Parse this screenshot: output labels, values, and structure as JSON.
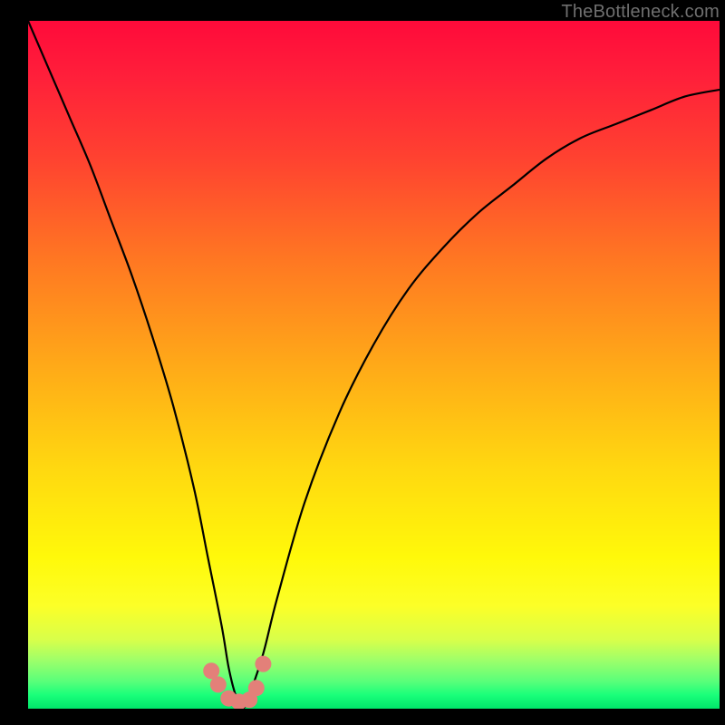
{
  "watermark": "TheBottleneck.com",
  "chart_data": {
    "type": "line",
    "title": "",
    "xlabel": "",
    "ylabel": "",
    "xlim": [
      0,
      100
    ],
    "ylim": [
      0,
      100
    ],
    "series": [
      {
        "name": "bottleneck-curve",
        "x": [
          0,
          3,
          6,
          9,
          12,
          15,
          18,
          21,
          24,
          26,
          28,
          29,
          30,
          31,
          32,
          34,
          36,
          40,
          45,
          50,
          55,
          60,
          65,
          70,
          75,
          80,
          85,
          90,
          95,
          100
        ],
        "values": [
          100,
          93,
          86,
          79,
          71,
          63,
          54,
          44,
          32,
          22,
          12,
          6,
          2,
          0,
          2,
          8,
          16,
          30,
          43,
          53,
          61,
          67,
          72,
          76,
          80,
          83,
          85,
          87,
          89,
          90
        ]
      }
    ],
    "markers": {
      "name": "highlight-points",
      "x": [
        26.5,
        27.5,
        29.0,
        30.5,
        32.0,
        33.0,
        34.0
      ],
      "values": [
        5.5,
        3.5,
        1.5,
        1.0,
        1.3,
        3.0,
        6.5
      ]
    },
    "colors": {
      "curve": "#000000",
      "marker": "#e38079"
    }
  }
}
